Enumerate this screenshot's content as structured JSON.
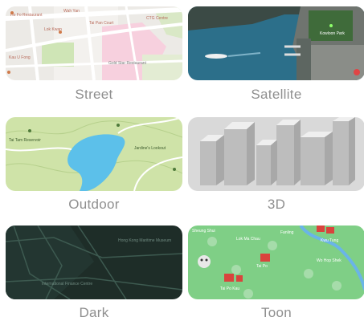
{
  "styles": [
    {
      "id": "street",
      "label": "Street"
    },
    {
      "id": "satellite",
      "label": "Satellite"
    },
    {
      "id": "outdoor",
      "label": "Outdoor"
    },
    {
      "id": "3d",
      "label": "3D"
    },
    {
      "id": "dark",
      "label": "Dark"
    },
    {
      "id": "toon",
      "label": "Toon"
    }
  ],
  "map_text": {
    "street_poi_1": "Ho Fo Restaurant",
    "street_poi_2": "Wah Yan",
    "street_poi_3": "Tai Pan Court",
    "street_poi_4": "Lok Kwan",
    "street_poi_5": "CTG Centre",
    "street_poi_6": "Kau U Fong",
    "street_poi_7": "Gold Star Restaurant",
    "satellite_park": "Kowloon Park",
    "outdoor_poi_1": "Tai Tam Reservoir",
    "outdoor_poi_2": "Jardine's Lookout",
    "dark_poi_1": "Hong Kong Maritime Museum",
    "dark_poi_2": "International Finance Centre",
    "toon_place_1": "Sheung Shui",
    "toon_place_2": "Lok Ma Chau",
    "toon_place_3": "Fanling",
    "toon_place_4": "Kwu Tung",
    "toon_place_5": "Tai Po",
    "toon_place_6": "Tai Po Kau",
    "toon_place_7": "Wo Hop Shek"
  },
  "colors": {
    "label_text": "#8f8f8f",
    "street_bg": "#eceae6",
    "satellite_water": "#2c6f8a",
    "outdoor_bg": "#cfe3a8",
    "outdoor_water": "#5cc0ea",
    "threed_bg": "#d9d9d9",
    "dark_bg": "#1e2d28",
    "toon_bg": "#7fcf86"
  }
}
